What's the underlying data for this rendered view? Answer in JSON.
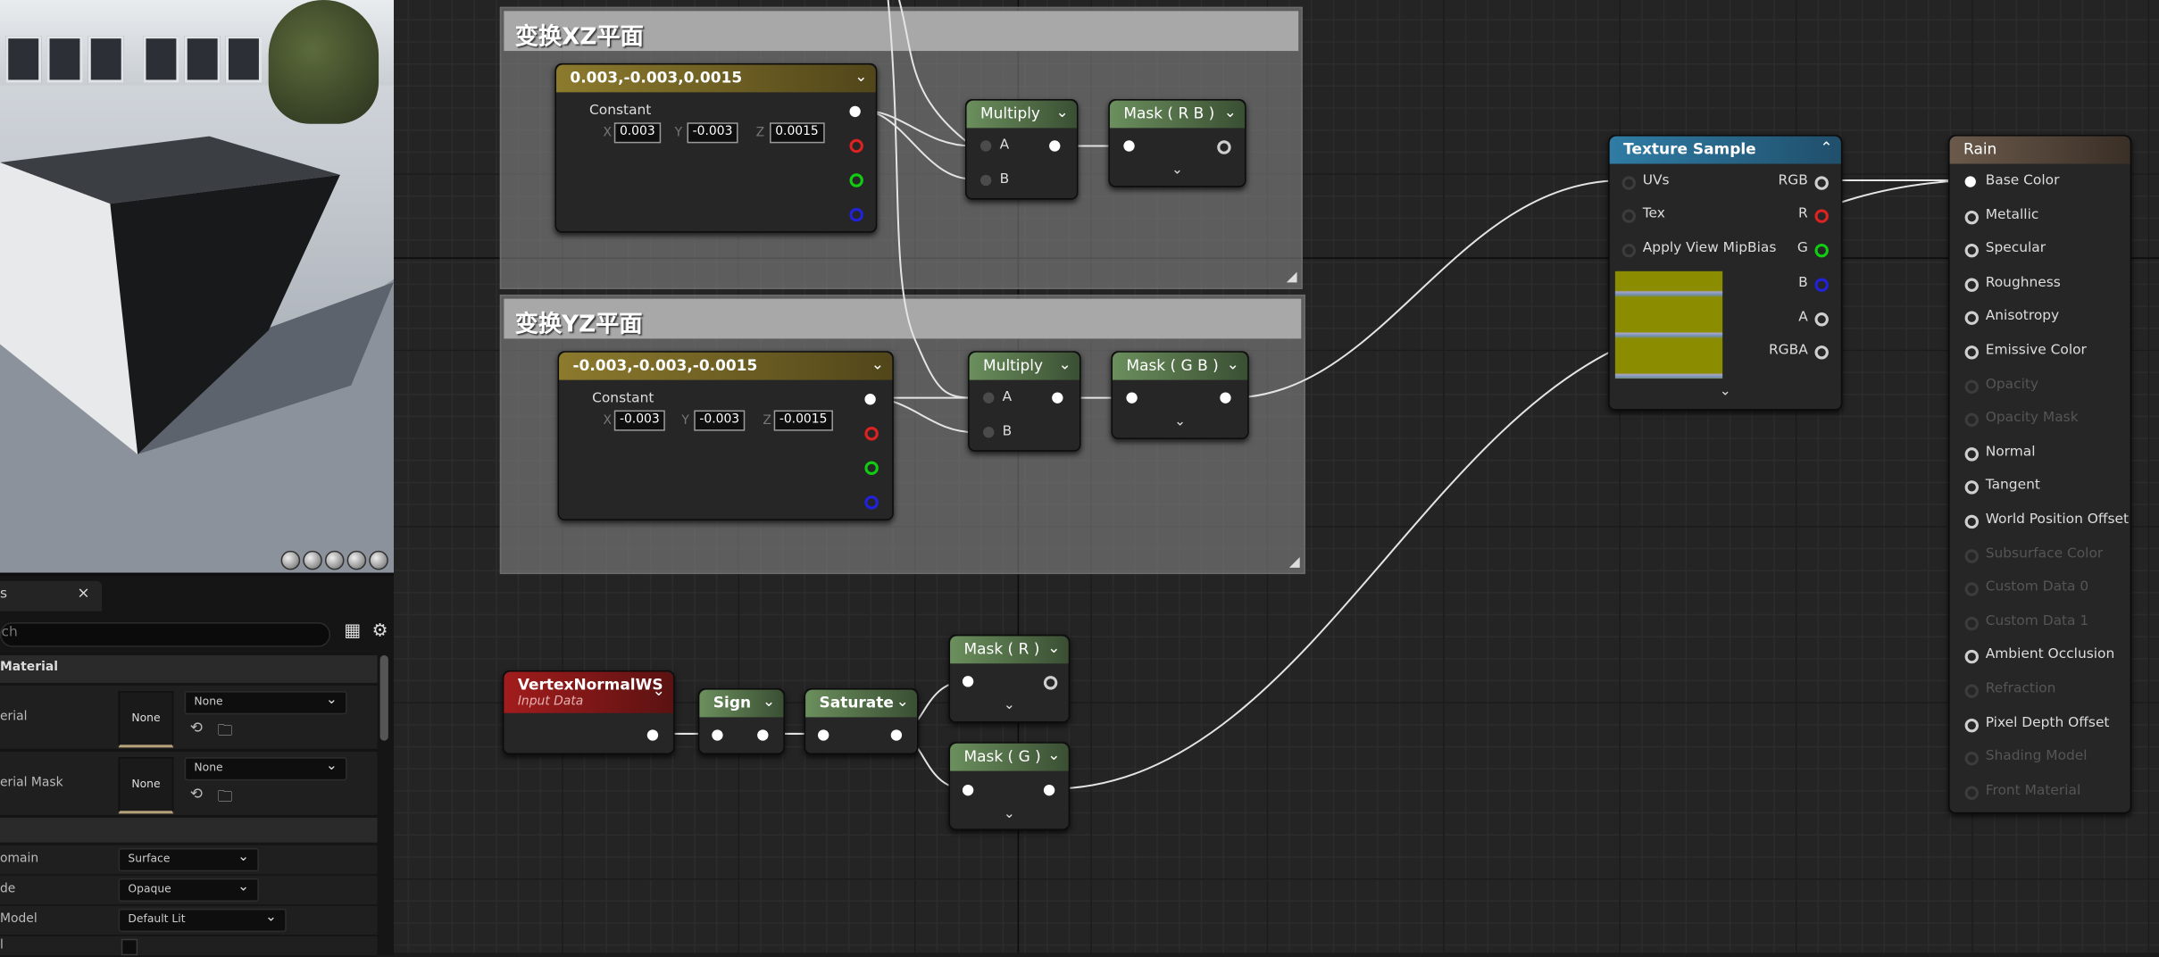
{
  "details": {
    "tab_label": "s",
    "tab_close": "×",
    "search_placeholder": "ch",
    "category": "Material",
    "rows": [
      {
        "label": "erial",
        "thumb": "None",
        "value": "None"
      },
      {
        "label": "erial Mask",
        "thumb": "None",
        "value": "None"
      }
    ],
    "props": [
      {
        "label": "omain",
        "value": "Surface"
      },
      {
        "label": "de",
        "value": "Opaque"
      },
      {
        "label": "Model",
        "value": "Default Lit"
      },
      {
        "label": "l",
        "value": ""
      }
    ]
  },
  "graph": {
    "comments": [
      {
        "title": "变换XZ平面"
      },
      {
        "title": "变换YZ平面"
      }
    ],
    "constants": [
      {
        "title": "0.003,-0.003,0.0015",
        "label": "Constant",
        "x": "0.003",
        "y": "-0.003",
        "z": "0.0015"
      },
      {
        "title": "-0.003,-0.003,-0.0015",
        "label": "Constant",
        "x": "-0.003",
        "y": "-0.003",
        "z": "-0.0015"
      }
    ],
    "axis_labels": {
      "x": "X",
      "y": "Y",
      "z": "Z"
    },
    "multiply": {
      "title": "Multiply",
      "pin_a": "A",
      "pin_b": "B"
    },
    "masks": {
      "rb": "Mask ( R B )",
      "gb": "Mask ( G B )",
      "r": "Mask ( R )",
      "g": "Mask ( G )"
    },
    "vertex_normal": {
      "title": "VertexNormalWS",
      "subtitle": "Input Data"
    },
    "sign": {
      "title": "Sign"
    },
    "saturate": {
      "title": "Saturate"
    },
    "texture_sample": {
      "title": "Texture Sample",
      "inputs": [
        "UVs",
        "Tex",
        "Apply View MipBias"
      ],
      "outputs": [
        "RGB",
        "R",
        "G",
        "B",
        "A",
        "RGBA"
      ]
    },
    "material": {
      "title": "Rain",
      "pins": [
        {
          "label": "Base Color",
          "enabled": true
        },
        {
          "label": "Metallic",
          "enabled": true
        },
        {
          "label": "Specular",
          "enabled": true
        },
        {
          "label": "Roughness",
          "enabled": true
        },
        {
          "label": "Anisotropy",
          "enabled": true
        },
        {
          "label": "Emissive Color",
          "enabled": true
        },
        {
          "label": "Opacity",
          "enabled": false
        },
        {
          "label": "Opacity Mask",
          "enabled": false
        },
        {
          "label": "Normal",
          "enabled": true
        },
        {
          "label": "Tangent",
          "enabled": true
        },
        {
          "label": "World Position Offset",
          "enabled": true
        },
        {
          "label": "Subsurface Color",
          "enabled": false
        },
        {
          "label": "Custom Data 0",
          "enabled": false
        },
        {
          "label": "Custom Data 1",
          "enabled": false
        },
        {
          "label": "Ambient Occlusion",
          "enabled": true
        },
        {
          "label": "Refraction",
          "enabled": false
        },
        {
          "label": "Pixel Depth Offset",
          "enabled": true
        },
        {
          "label": "Shading Model",
          "enabled": false
        },
        {
          "label": "Front Material",
          "enabled": false
        }
      ]
    },
    "colors": {
      "comment": "#a8a8a8",
      "gold": "#8c7a2d",
      "green": "#6b8f5d",
      "blue": "#2f7ca5",
      "red": "#a21c1c",
      "wire": "#e0e0e0"
    }
  }
}
